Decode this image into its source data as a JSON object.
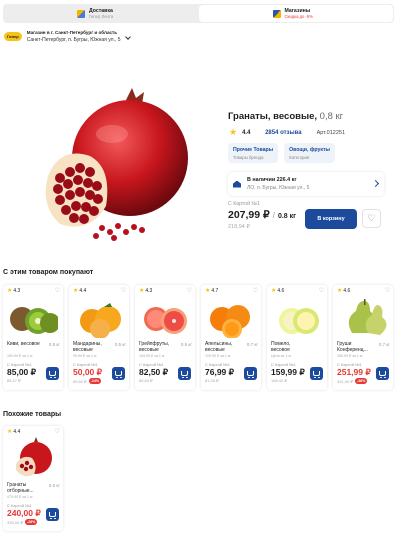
{
  "tabs": [
    {
      "title": "Доставка",
      "subtitle": "Гипер Лента"
    },
    {
      "title": "Магазины",
      "subtitle": "Скидка до -5%"
    }
  ],
  "location": {
    "badge": "Гипер",
    "store": "Магазин в г. Санкт-Петербург и область",
    "address": "Санкт-Петербург, п. Бугры, Южная ул., 5"
  },
  "product": {
    "name": "Гранаты, весовые,",
    "weight": "0,8 кг",
    "rating": "4.4",
    "reviews": "2854 отзыва",
    "article": "Арт.012251",
    "chips": [
      {
        "title": "Прочие Товары",
        "subtitle": "Товары бренда"
      },
      {
        "title": "Овощи, фрукты",
        "subtitle": "Категория"
      }
    ],
    "stock_text": "В наличии",
    "stock_qty": "226.4 кг",
    "stock_address": "ЛО, п. Бугры, Южная ул., 5",
    "card_label": "С Картой №1",
    "price": "207,99 ₽",
    "price_sep": "/",
    "price_weight": "0.8 кг",
    "old_price": "218,94 ₽",
    "cart_label": "В корзину",
    "fav_icon": "heart-icon"
  },
  "colors": {
    "accent": "#1c4a9c",
    "sale": "#e53935",
    "star": "#f6c318"
  },
  "also_bought": {
    "title": "С этим товаром покупают",
    "items": [
      {
        "rating": "4.3",
        "name": "Киви, весовое",
        "weight": "0.5 кг",
        "unit": "169.99 ₽ за 1 кг",
        "card": "С Картой №1",
        "price": "85,00 ₽",
        "old": "85,47 ₽",
        "disc": "",
        "sale": false,
        "fruit": "kiwi"
      },
      {
        "rating": "4.4",
        "name": "Мандарины, весовые",
        "weight": "0.5 кг",
        "unit": "99.99 ₽ за 1 кг",
        "card": "С Картой №1",
        "price": "50,00 ₽",
        "old": "65,60 ₽",
        "disc": "-24%",
        "sale": true,
        "fruit": "mandarin"
      },
      {
        "rating": "4.3",
        "name": "Грейпфруты, весовые",
        "weight": "0.5 кг",
        "unit": "164.99 ₽ за 1 кг",
        "card": "С Картой №1",
        "price": "82,50 ₽",
        "old": "86,84 ₽",
        "disc": "",
        "sale": false,
        "fruit": "grapefruit"
      },
      {
        "rating": "4.7",
        "name": "Апельсины, весовые",
        "weight": "0.7 кг",
        "unit": "109.99 ₽ за 1 кг",
        "card": "С Картой №1",
        "price": "76,99 ₽",
        "old": "81,05 ₽",
        "disc": "",
        "sale": false,
        "fruit": "orange"
      },
      {
        "rating": "4.6",
        "name": "Помело, весовое",
        "weight": "",
        "unit": "Цена за 1 кг",
        "card": "С Картой №1",
        "price": "159,99 ₽",
        "old": "168,42 ₽",
        "disc": "",
        "sale": false,
        "fruit": "pomelo"
      },
      {
        "rating": "4.6",
        "name": "Груши Конференц...",
        "weight": "0.7 кг",
        "unit": "359.99 ₽ за 1 кг",
        "card": "С Картой №1",
        "price": "251,99 ₽",
        "old": "391,00 ₽",
        "disc": "-38%",
        "sale": true,
        "fruit": "pear"
      }
    ]
  },
  "similar": {
    "title": "Похожие товары",
    "items": [
      {
        "rating": "4.4",
        "name": "Гранаты отборные...",
        "weight": "0.5 кг",
        "unit": "479.99 ₽ за 1 кг",
        "card": "С Картой №1",
        "price": "240,00 ₽",
        "old": "335,00 ₽",
        "disc": "-28%",
        "sale": true,
        "fruit": "pomegranate"
      }
    ]
  }
}
